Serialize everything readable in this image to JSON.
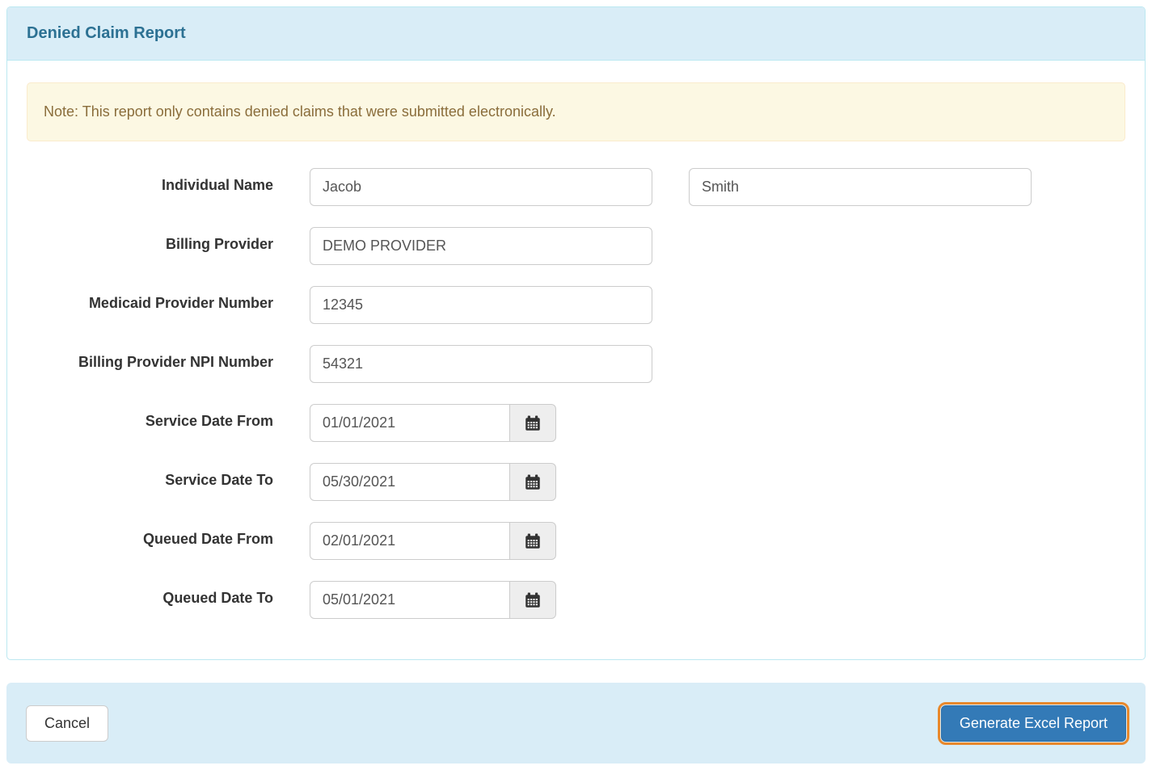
{
  "panel": {
    "title": "Denied Claim Report"
  },
  "note": {
    "text": "Note: This report only contains denied claims that were submitted electronically."
  },
  "form": {
    "individual_name": {
      "label": "Individual Name",
      "first_value": "Jacob",
      "last_value": "Smith"
    },
    "billing_provider": {
      "label": "Billing Provider",
      "value": "DEMO PROVIDER"
    },
    "medicaid_provider_number": {
      "label": "Medicaid Provider Number",
      "value": "12345"
    },
    "billing_provider_npi": {
      "label": "Billing Provider NPI Number",
      "value": "54321"
    },
    "service_date_from": {
      "label": "Service Date From",
      "value": "01/01/2021"
    },
    "service_date_to": {
      "label": "Service Date To",
      "value": "05/30/2021"
    },
    "queued_date_from": {
      "label": "Queued Date From",
      "value": "02/01/2021"
    },
    "queued_date_to": {
      "label": "Queued Date To",
      "value": "05/01/2021"
    }
  },
  "footer": {
    "cancel_label": "Cancel",
    "generate_label": "Generate Excel Report"
  },
  "icons": {
    "calendar": "calendar-icon"
  },
  "colors": {
    "header_bg": "#d9edf7",
    "header_text": "#2c7193",
    "panel_border": "#bce8f1",
    "note_bg": "#fcf8e3",
    "note_border": "#faebcc",
    "note_text": "#8a6d3b",
    "primary_button_bg": "#337ab7",
    "focus_outline": "#e8882b"
  }
}
